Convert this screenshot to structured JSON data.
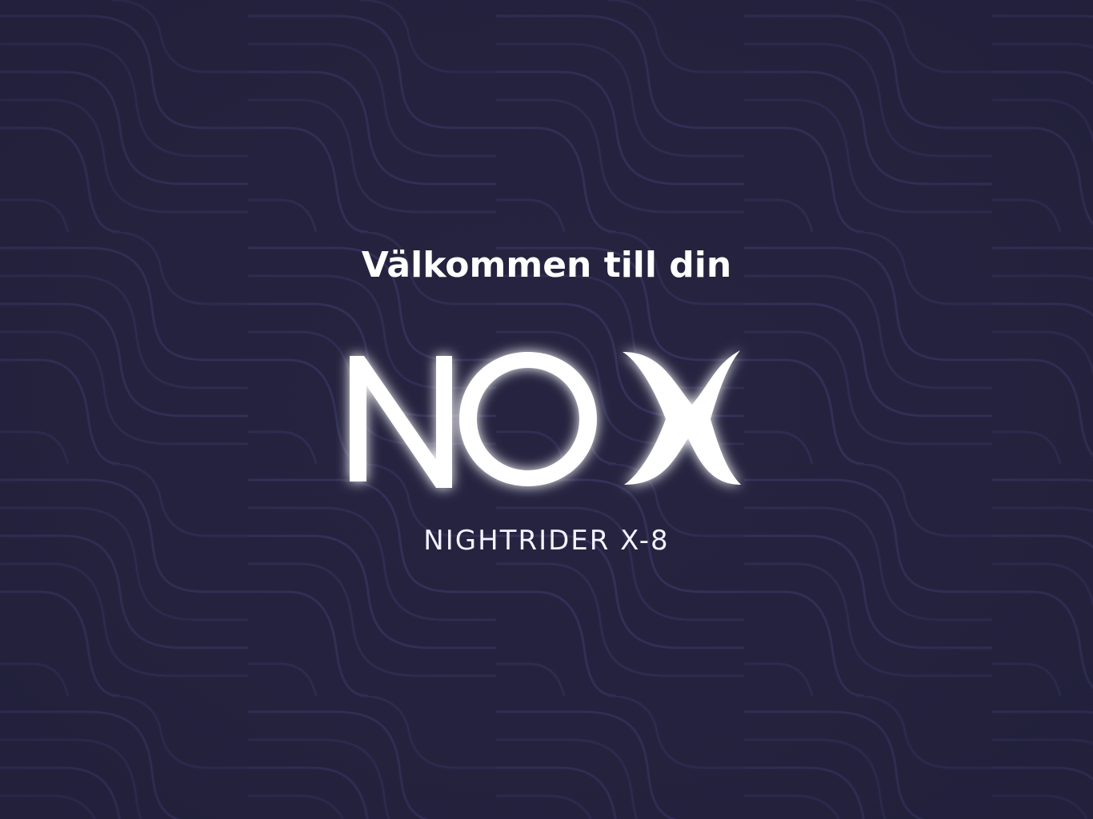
{
  "screen": {
    "welcome_text": "Välkommen till din",
    "brand_name": "NOX",
    "model_name": "NIGHTRIDER X-8"
  },
  "colors": {
    "background": "#25233f",
    "pattern_line": "#37355a",
    "text": "#ffffff",
    "logo_glow": "#c9b8ff"
  },
  "icons": {
    "logo": "nox-logo"
  }
}
